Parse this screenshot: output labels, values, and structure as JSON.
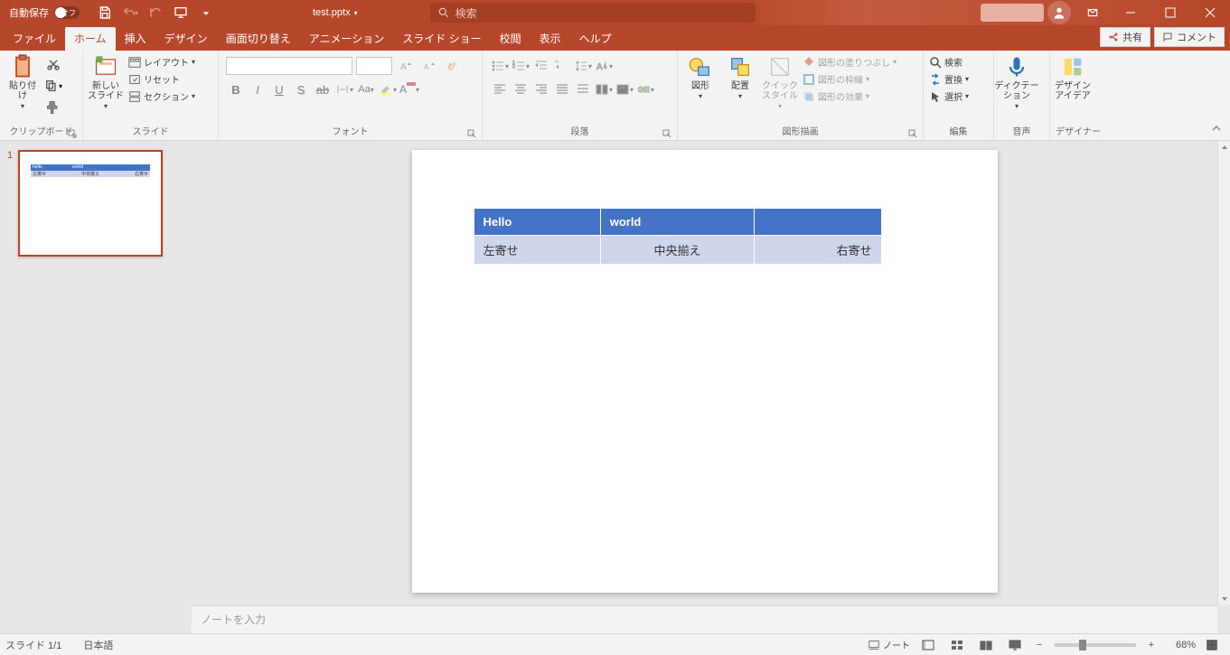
{
  "titlebar": {
    "autosave_label": "自動保存",
    "autosave_state": "オフ",
    "filename": "test.pptx",
    "search_placeholder": "検索"
  },
  "tabs": {
    "file": "ファイル",
    "home": "ホーム",
    "insert": "挿入",
    "design": "デザイン",
    "transitions": "画面切り替え",
    "animations": "アニメーション",
    "slideshow": "スライド ショー",
    "review": "校閲",
    "view": "表示",
    "help": "ヘルプ",
    "share": "共有",
    "comment": "コメント"
  },
  "ribbon": {
    "clipboard": {
      "paste": "貼り付け",
      "group": "クリップボード"
    },
    "slides": {
      "new_slide": "新しい\nスライド",
      "layout": "レイアウト",
      "reset": "リセット",
      "section": "セクション",
      "group": "スライド"
    },
    "font": {
      "group": "フォント"
    },
    "paragraph": {
      "group": "段落"
    },
    "drawing": {
      "shapes": "図形",
      "arrange": "配置",
      "quick": "クイック\nスタイル",
      "fill": "図形の塗りつぶし",
      "outline": "図形の枠線",
      "effects": "図形の効果",
      "group": "図形描画"
    },
    "editing": {
      "find": "検索",
      "replace": "置換",
      "select": "選択",
      "group": "編集"
    },
    "voice": {
      "dictate": "ディクテー\nション",
      "group": "音声"
    },
    "designer": {
      "ideas": "デザイン\nアイデア",
      "group": "デザイナー"
    }
  },
  "thumbnails": [
    {
      "number": "1",
      "header": [
        "hello",
        "world",
        ""
      ],
      "body": [
        "左寄せ",
        "中央揃え",
        "右寄せ"
      ]
    }
  ],
  "slide": {
    "table": {
      "header": [
        "Hello",
        "world",
        ""
      ],
      "body": [
        "左寄せ",
        "中央揃え",
        "右寄せ"
      ]
    }
  },
  "notes": {
    "placeholder": "ノートを入力"
  },
  "statusbar": {
    "slide_counter": "スライド 1/1",
    "language": "日本語",
    "notes_btn": "ノート",
    "zoom": "68%"
  }
}
